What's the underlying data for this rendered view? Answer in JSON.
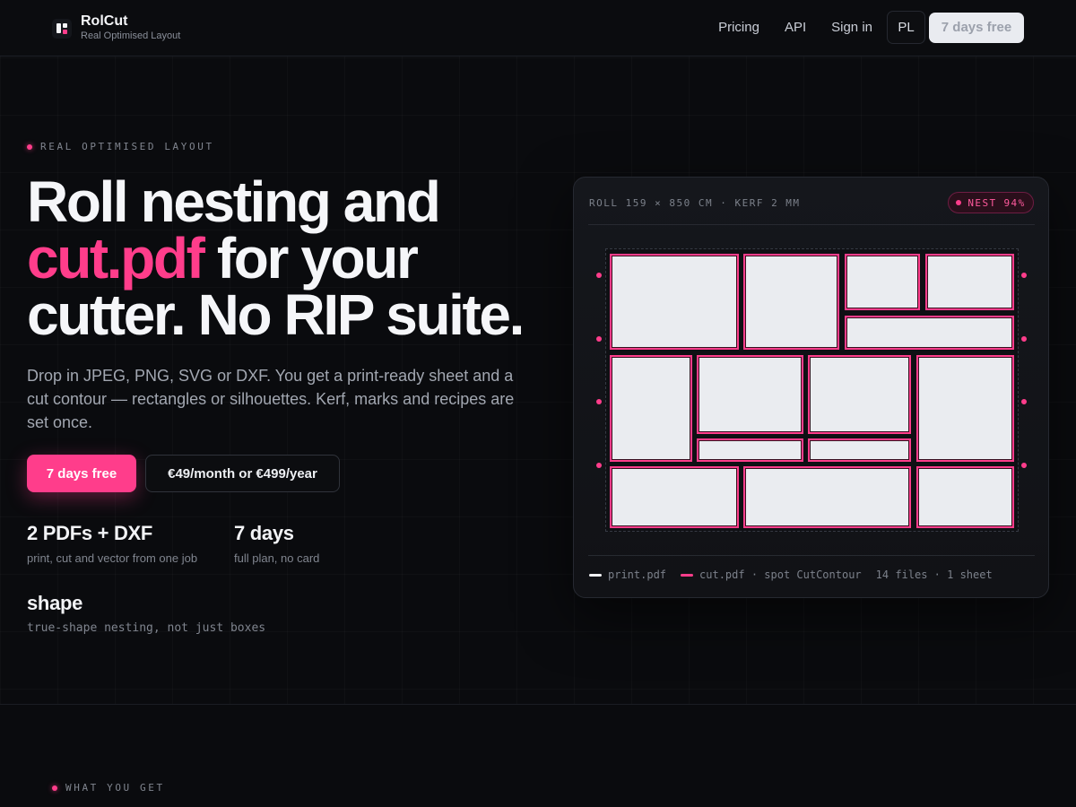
{
  "header": {
    "brand_name": "RolCut",
    "brand_tagline": "Real Optimised Layout",
    "nav": [
      "Pricing",
      "API",
      "Sign in"
    ],
    "lang": "PL",
    "cta": "7 days free"
  },
  "hero": {
    "eyebrow": "REAL OPTIMISED LAYOUT",
    "headline_line1": "Roll nesting and",
    "headline_pink": "cut.pdf",
    "headline_line2_rest": " for your",
    "headline_line3": "cutter. No RIP suite.",
    "lead": "Drop in JPEG, PNG, SVG or DXF. You get a print-ready sheet and a cut contour — rectangles or silhouettes. Kerf, marks and recipes are set once.",
    "primary_button": "7 days free",
    "secondary_button": "€49/month or €499/year",
    "stats": [
      {
        "value": "2 PDFs + DXF",
        "caption": "print, cut and vector from one job"
      },
      {
        "value": "7 days",
        "caption": "full plan, no card"
      },
      {
        "value": "shape",
        "caption": "true-shape nesting, not just boxes"
      }
    ]
  },
  "preview": {
    "title": "ROLL 159 × 850 CM · KERF 2 MM",
    "badge": "NEST 94%",
    "legend": {
      "print": "print.pdf",
      "cut": "cut.pdf · spot CutContour",
      "summary": "14 files · 1 sheet"
    },
    "colors": {
      "accent": "#ff3d8b",
      "piece": "#eaecf0"
    }
  },
  "next_section": {
    "eyebrow": "WHAT YOU GET"
  }
}
